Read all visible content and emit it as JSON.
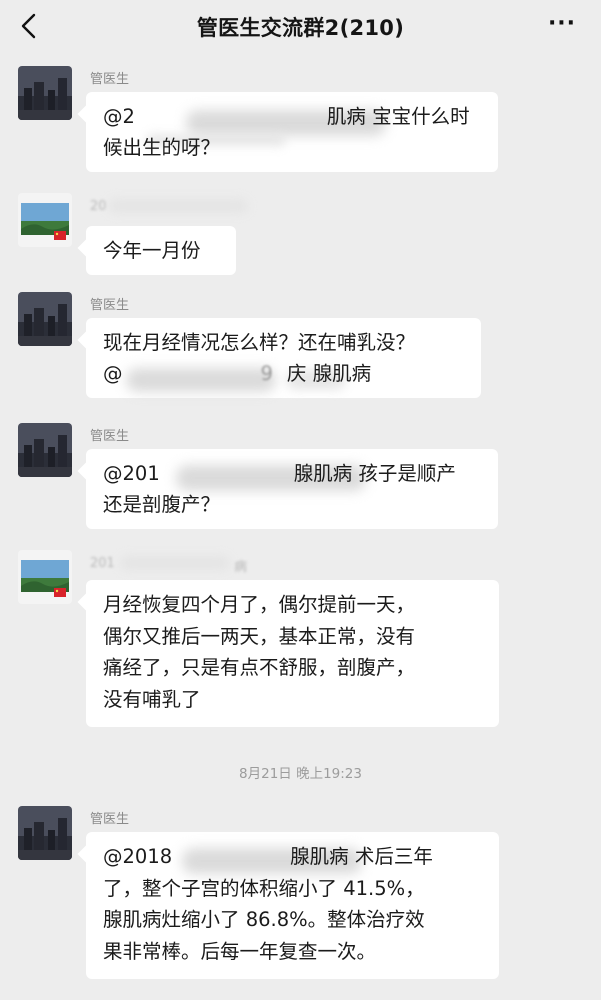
{
  "header": {
    "title": "管医生交流群2(210)",
    "back_icon": "chevron-left-icon",
    "more_icon": "more-dots-icon",
    "more_label": "···"
  },
  "messages": [
    {
      "sender": "管医生",
      "avatar": "city-night-avatar",
      "lines": [
        "@2",
        "肌病  宝宝什么时",
        "候出生的呀？"
      ]
    },
    {
      "sender": "20",
      "avatar": "landscape-flag-avatar",
      "lines": [
        "今年一月份"
      ]
    },
    {
      "sender": "管医生",
      "avatar": "city-night-avatar",
      "lines": [
        "现在月经情况怎么样？还在哺乳没？",
        "@",
        "9",
        "庆 腺肌病"
      ]
    },
    {
      "sender": "管医生",
      "avatar": "city-night-avatar",
      "lines": [
        "@201",
        "腺肌病  孩子是顺产",
        "还是剖腹产？"
      ]
    },
    {
      "sender": "201",
      "sender_tail": "病",
      "avatar": "landscape-flag-avatar",
      "lines": [
        "月经恢复四个月了，偶尔提前一天，",
        "偶尔又推后一两天，基本正常，没有",
        "痛经了，只是有点不舒服，剖腹产，",
        "没有哺乳了"
      ]
    },
    {
      "sender": "管医生",
      "avatar": "city-night-avatar",
      "lines": [
        "@2018",
        "腺肌病  术后三年",
        "了，整个子宫的体积缩小了 41.5%，",
        "腺肌病灶缩小了 86.8%。整体治疗效",
        "果非常棒。后每一年复查一次。"
      ]
    }
  ],
  "timestamp": "8月21日 晚上19:23",
  "colors": {
    "background": "#ededed",
    "bubble": "#ffffff",
    "flag": "#d8232a"
  }
}
